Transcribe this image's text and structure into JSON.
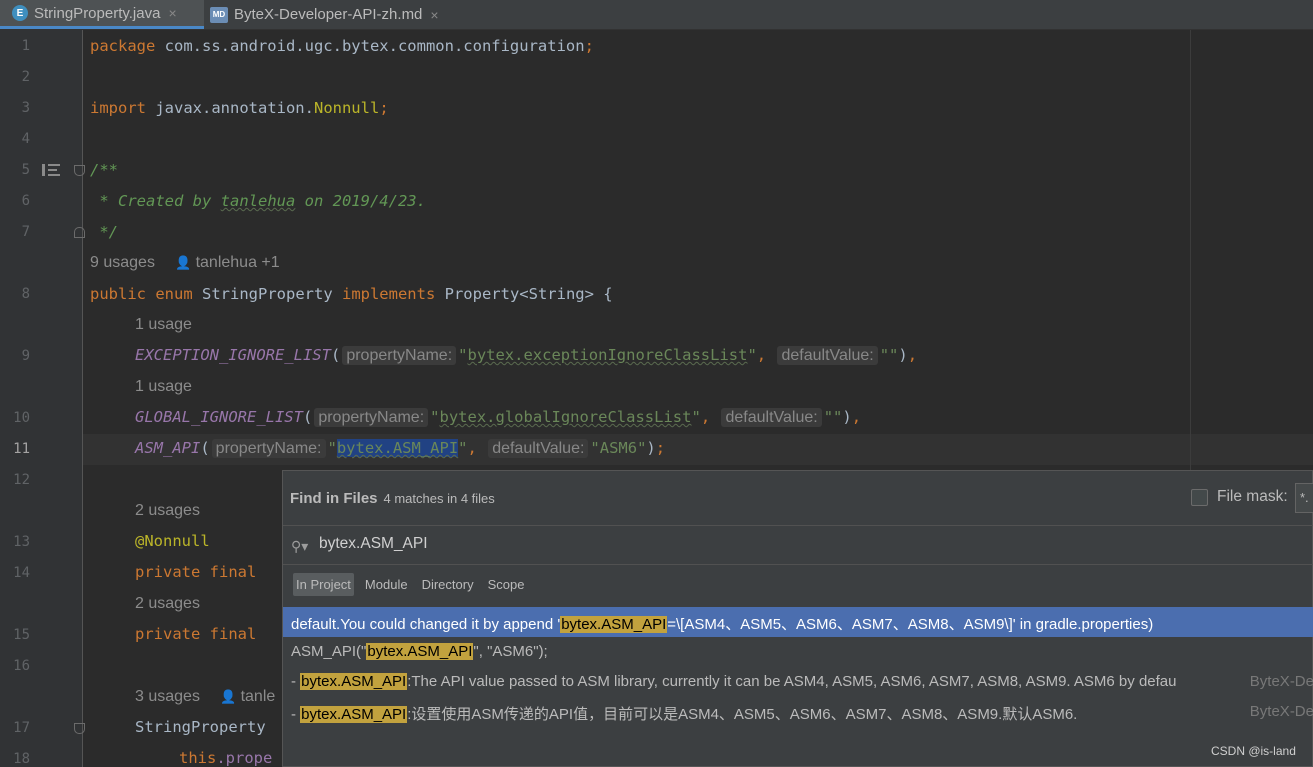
{
  "tabs": [
    {
      "icon": "E",
      "label": "StringProperty.java",
      "close": "×",
      "active": true
    },
    {
      "icon": "MD",
      "label": "ByteX-Developer-API-zh.md",
      "close": "×",
      "active": false
    }
  ],
  "line_numbers": [
    "1",
    "2",
    "3",
    "4",
    "5",
    "6",
    "7",
    "8",
    "9",
    "10",
    "11",
    "12",
    "13",
    "14",
    "15",
    "16",
    "17",
    "18"
  ],
  "code": {
    "l1_kw": "package",
    "l1_rest": " com.ss.android.ugc.bytex.common.configuration",
    "l3_kw": "import",
    "l3_rest": " javax.annotation.",
    "l3_ann": "Nonnull",
    "l5": "/**",
    "l6_pre": " * Created by ",
    "l6_author": "tanlehua",
    "l6_post": " on 2019/4/23.",
    "l7": " */",
    "meta1_usages": "9 usages",
    "meta1_author": "tanlehua +1",
    "l8_kw1": "public",
    "l8_kw2": "enum",
    "l8_name": " StringProperty ",
    "l8_kw3": "implements",
    "l8_rest": " Property<String> {",
    "meta2": "1 usage",
    "l9_enum": "EXCEPTION_IGNORE_LIST",
    "l9_hint1": "propertyName:",
    "l9_str1": "bytex.exceptionIgnoreClassList",
    "l9_hint2": "defaultValue:",
    "l9_str2": "\"\"",
    "meta3": "1 usage",
    "l10_enum": "GLOBAL_IGNORE_LIST",
    "l10_hint1": "propertyName:",
    "l10_str1": "bytex.globalIgnoreClassList",
    "l10_hint2": "defaultValue:",
    "l10_str2": "\"\"",
    "l11_enum": "ASM_API",
    "l11_hint1": "propertyName:",
    "l11_str1": "bytex.ASM_API",
    "l11_hint2": "defaultValue:",
    "l11_str2": "\"ASM6\"",
    "meta4": "2 usages",
    "l13_ann": "@Nonnull",
    "l14_kw": "private final",
    "meta5": "2 usages",
    "l15_kw": "private final",
    "meta6_usages": "3 usages",
    "meta6_author": "tanle",
    "l17": "StringProperty",
    "l18_kw": "this",
    ".l18_rest": ".prope"
  },
  "find": {
    "title": "Find in Files",
    "count": "4 matches in 4 files",
    "file_mask_label": "File mask:",
    "file_mask_value": "*.",
    "query": "bytex.ASM_API",
    "scopes": [
      "In Project",
      "Module",
      "Directory",
      "Scope"
    ],
    "results": [
      {
        "pre": "default.You could changed it by append '",
        "match": "bytex.ASM_API",
        "post": "=\\[ASM4、ASM5、ASM6、ASM7、ASM8、ASM9\\]' in gradle.properties)",
        "file": ""
      },
      {
        "pre": "ASM_API(\"",
        "match": "bytex.ASM_API",
        "post": "\", \"ASM6\");",
        "file": ""
      },
      {
        "pre": "- ",
        "match": "bytex.ASM_API",
        "post": ":The API value passed to ASM library, currently it can be ASM4, ASM5, ASM6, ASM7, ASM8, ASM9. ASM6 by defau",
        "file": "ByteX-De"
      },
      {
        "pre": "- ",
        "match": "bytex.ASM_API",
        "post": ":设置使用ASM传递的API值，目前可以是ASM4、ASM5、ASM6、ASM7、ASM8、ASM9.默认ASM6.",
        "file": "ByteX-De"
      }
    ]
  },
  "watermark": "CSDN @is-land"
}
